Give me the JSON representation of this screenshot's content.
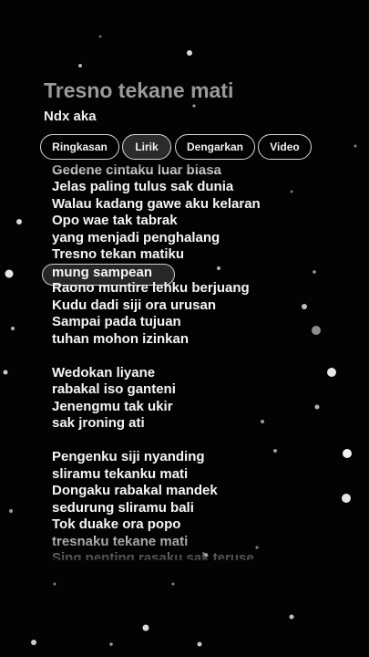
{
  "song": {
    "title": "Tresno tekane mati",
    "artist": "Ndx aka"
  },
  "tabs": [
    {
      "label": "Ringkasan",
      "active": false
    },
    {
      "label": "Lirik",
      "active": true
    },
    {
      "label": "Dengarkan",
      "active": false
    },
    {
      "label": "Video",
      "active": false
    }
  ],
  "lyrics": {
    "current_line": "mung sampean",
    "lines": [
      "Gedene cintaku luar biasa",
      "Jelas paling tulus sak dunia",
      "Walau kadang gawe aku kelaran",
      "Opo wae tak tabrak",
      "yang menjadi penghalang",
      "Tresno tekan matiku",
      "mung sampean",
      "Raono muntire lehku berjuang",
      "Kudu dadi siji ora urusan",
      "Sampai pada tujuan",
      "tuhan mohon izinkan",
      "",
      "Wedokan liyane",
      "rabakal iso ganteni",
      "Jenengmu tak ukir",
      "sak jroning ati",
      "",
      "Pengenku siji nyanding",
      "sliramu tekanku mati",
      "Dongaku rabakal mandek",
      "sedurung sliramu bali",
      "Tok duake ora popo",
      "tresnaku tekane mati",
      "Sing penting rasaku sak teruse"
    ]
  },
  "colors": {
    "background": "#030303",
    "title": "#9a9a9a",
    "text": "#f5f5f5",
    "chip_border": "#d9d9d9"
  }
}
